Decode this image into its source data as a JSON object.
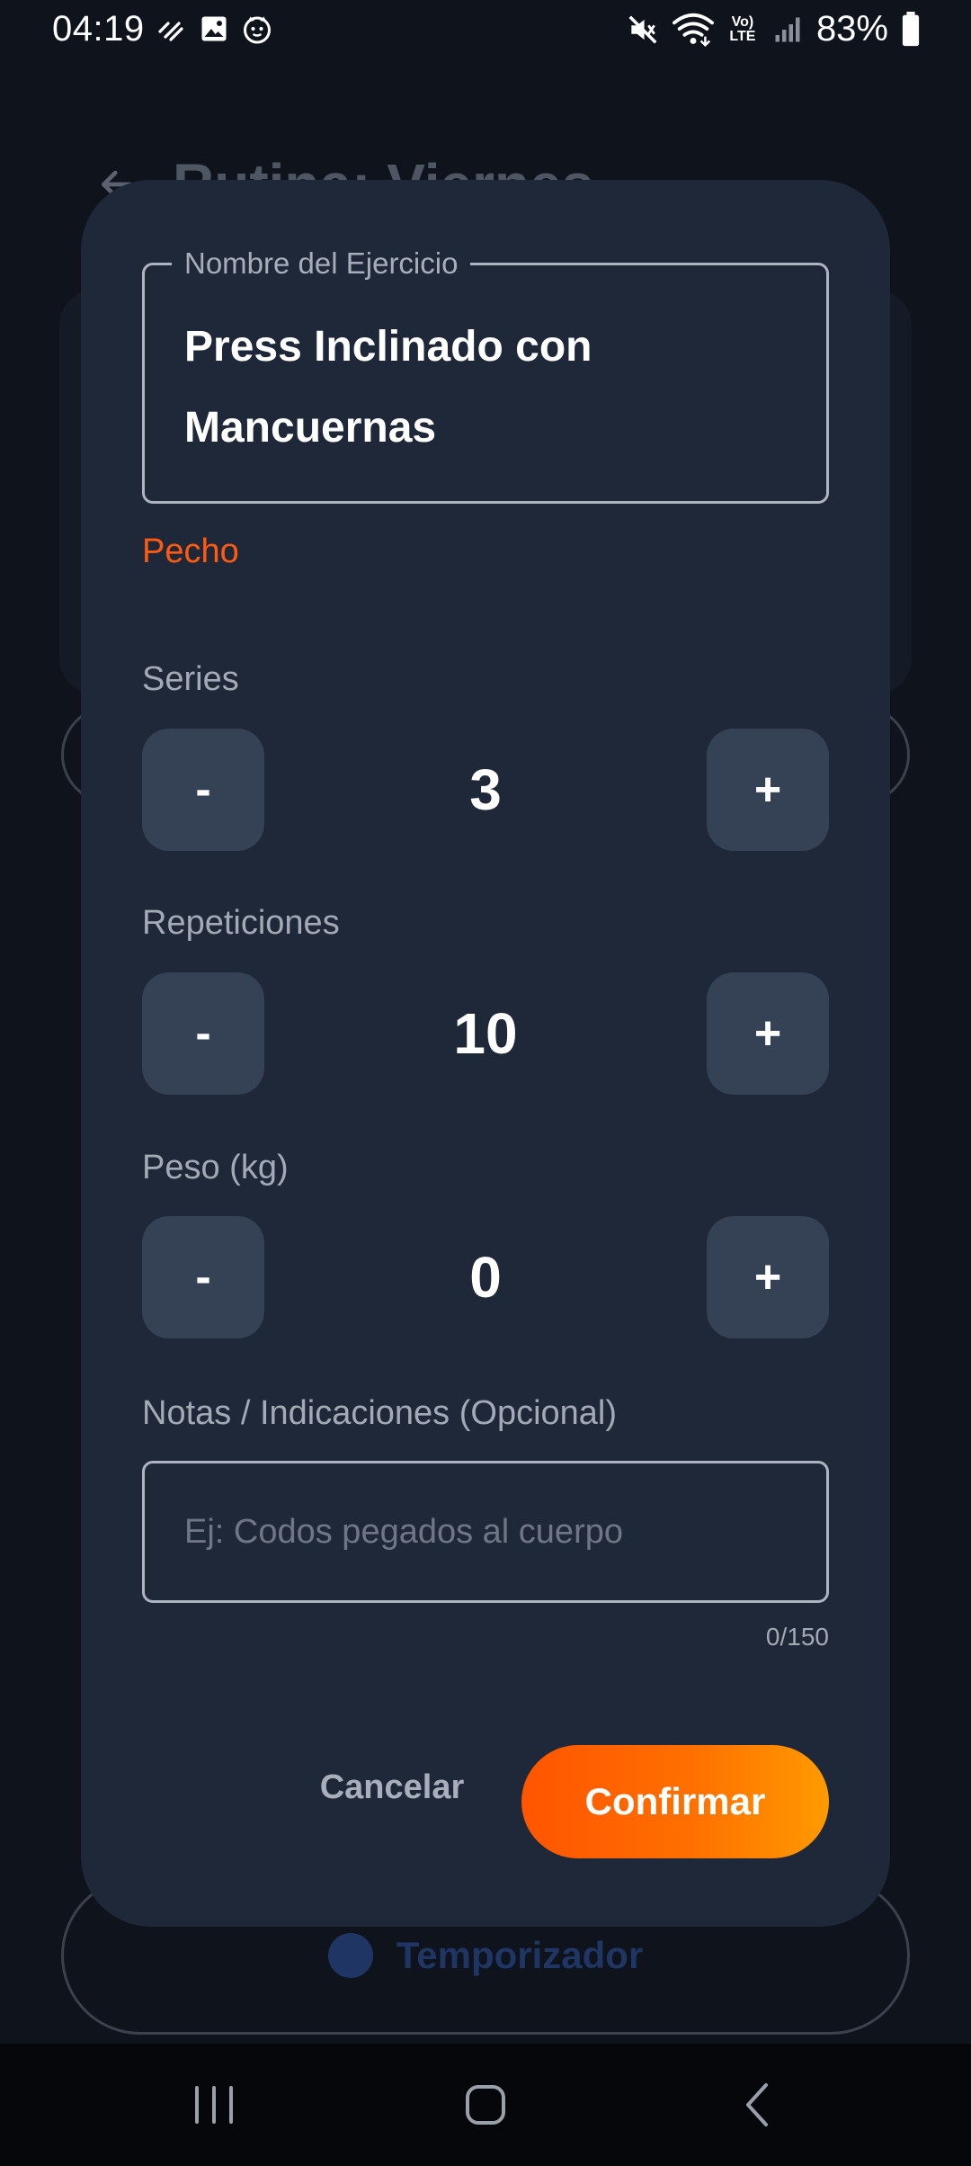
{
  "status_bar": {
    "time": "04:19",
    "battery": "83%",
    "icons_left": [
      "data-saver-icon",
      "image-icon",
      "cat-face-icon"
    ],
    "icons_right": [
      "mute-icon",
      "wifi-icon",
      "volte-icon",
      "signal-icon",
      "battery-icon"
    ],
    "volte_text": "Vo) LTE"
  },
  "background_page": {
    "title": "Rutina: Viernes",
    "timer_label": "Temporizador"
  },
  "dialog": {
    "name_field": {
      "label": "Nombre del Ejercicio",
      "value": "Press Inclinado con Mancuernas"
    },
    "category": "Pecho",
    "steppers": [
      {
        "label": "Series",
        "value": "3",
        "minus": "-",
        "plus": "+"
      },
      {
        "label": "Repeticiones",
        "value": "10",
        "minus": "-",
        "plus": "+"
      },
      {
        "label": "Peso (kg)",
        "value": "0",
        "minus": "-",
        "plus": "+"
      }
    ],
    "notes": {
      "label": "Notas / Indicaciones (Opcional)",
      "placeholder": "Ej: Codos pegados al cuerpo",
      "value": "",
      "counter": "0/150"
    },
    "cancel_label": "Cancelar",
    "confirm_label": "Confirmar"
  },
  "colors": {
    "dialog_bg": "#1f2839",
    "accent_orange": "#ff5a12",
    "stepper_button_bg": "#354155"
  }
}
